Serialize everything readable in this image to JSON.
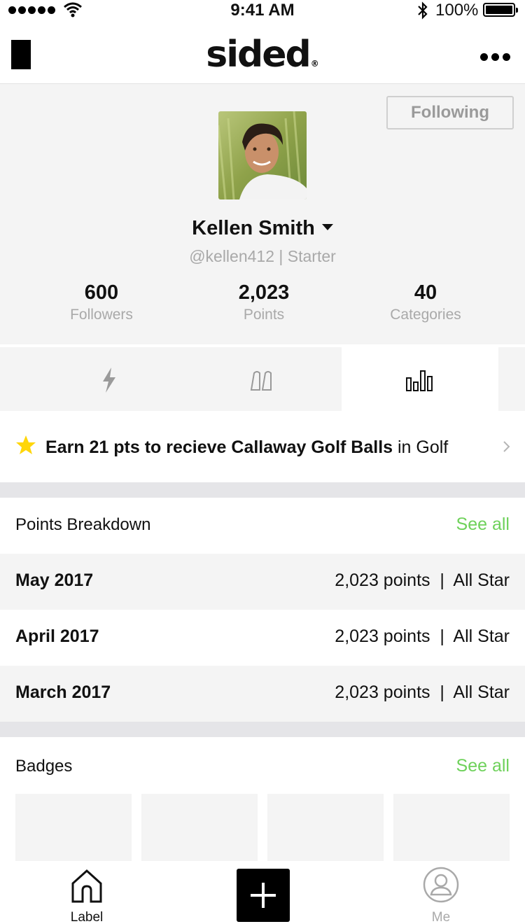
{
  "status_bar": {
    "time": "9:41 AM",
    "battery": "100%"
  },
  "nav": {
    "logo": "sided",
    "logo_mark": "®"
  },
  "profile": {
    "follow_button": "Following",
    "name": "Kellen Smith",
    "handle": "@kellen412 | Starter",
    "stats": [
      {
        "value": "600",
        "label": "Followers"
      },
      {
        "value": "2,023",
        "label": "Points"
      },
      {
        "value": "40",
        "label": "Categories"
      }
    ]
  },
  "tabs": [
    {
      "icon": "lightning-icon"
    },
    {
      "icon": "quotes-icon"
    },
    {
      "icon": "bar-chart-icon",
      "active": true
    }
  ],
  "reward": {
    "bold_text": "Earn 21 pts to recieve Callaway Golf Balls",
    "suffix_text": " in Golf",
    "star_color": "#ffd60a"
  },
  "points_breakdown": {
    "title": "Points Breakdown",
    "see_all": "See all",
    "rows": [
      {
        "month": "May 2017",
        "detail": "2,023 points  |  All Star"
      },
      {
        "month": "April 2017",
        "detail": "2,023 points  |  All Star"
      },
      {
        "month": "March 2017",
        "detail": "2,023 points  |  All Star"
      }
    ]
  },
  "badges": {
    "title": "Badges",
    "see_all": "See all"
  },
  "tab_bar": {
    "items": [
      {
        "label": "Label",
        "icon": "home-icon"
      },
      {
        "label": "",
        "icon": "plus-icon"
      },
      {
        "label": "Me",
        "icon": "profile-icon"
      }
    ]
  },
  "colors": {
    "accent": "#6ed15a",
    "star": "#ffd60a"
  }
}
